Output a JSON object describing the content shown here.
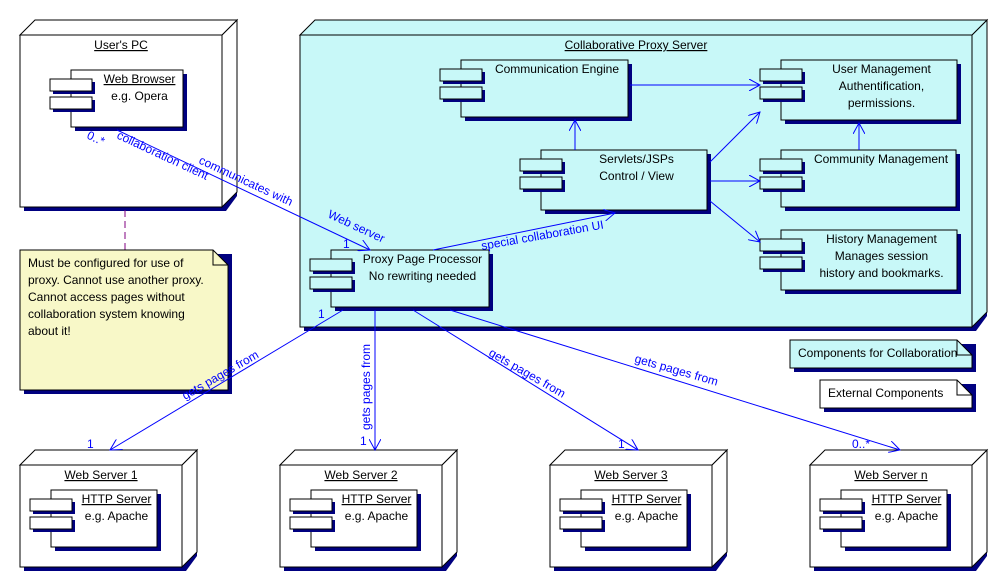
{
  "colors": {
    "server_fill": "#c8f8f8",
    "note_fill": "#f8f8c8",
    "shadow": "#000080",
    "edge": "#0000ff",
    "note_link": "#800080"
  },
  "nodes": {
    "users_pc": "User's PC",
    "proxy_server": "Collaborative Proxy Server",
    "ws1": "Web Server 1",
    "ws2": "Web Server 2",
    "ws3": "Web Server 3",
    "wsn": "Web Server n"
  },
  "components": {
    "browser": {
      "name": "Web Browser",
      "desc": "e.g. Opera"
    },
    "comm_engine": {
      "name": "Communication Engine"
    },
    "user_mgmt": {
      "name": "User Management",
      "desc1": "Authentification,",
      "desc2": "permissions."
    },
    "servlets": {
      "name": "Servlets/JSPs",
      "desc": "Control / View"
    },
    "community": {
      "name": "Community Management"
    },
    "history": {
      "name": "History Management",
      "desc1": "Manages session",
      "desc2": "history and bookmarks."
    },
    "proxy_pp": {
      "name": "Proxy Page Processor",
      "desc": "No rewriting needed"
    },
    "http": {
      "name": "HTTP Server",
      "desc": "e.g. Apache"
    }
  },
  "note": {
    "lines": [
      "Must be configured for use of",
      "proxy. Cannot use another proxy.",
      "Cannot access pages without",
      "collaboration system knowing",
      "about it!"
    ]
  },
  "legend": {
    "collab": "Components for Collaboration",
    "external": "External Components"
  },
  "edges": {
    "communicates": "communicates with",
    "client_role": "collaboration client",
    "server_role": "Web server",
    "mult_many": "0..*",
    "mult_one": "1",
    "special_ui": "special collaboration UI",
    "gets_pages": "gets pages from"
  }
}
